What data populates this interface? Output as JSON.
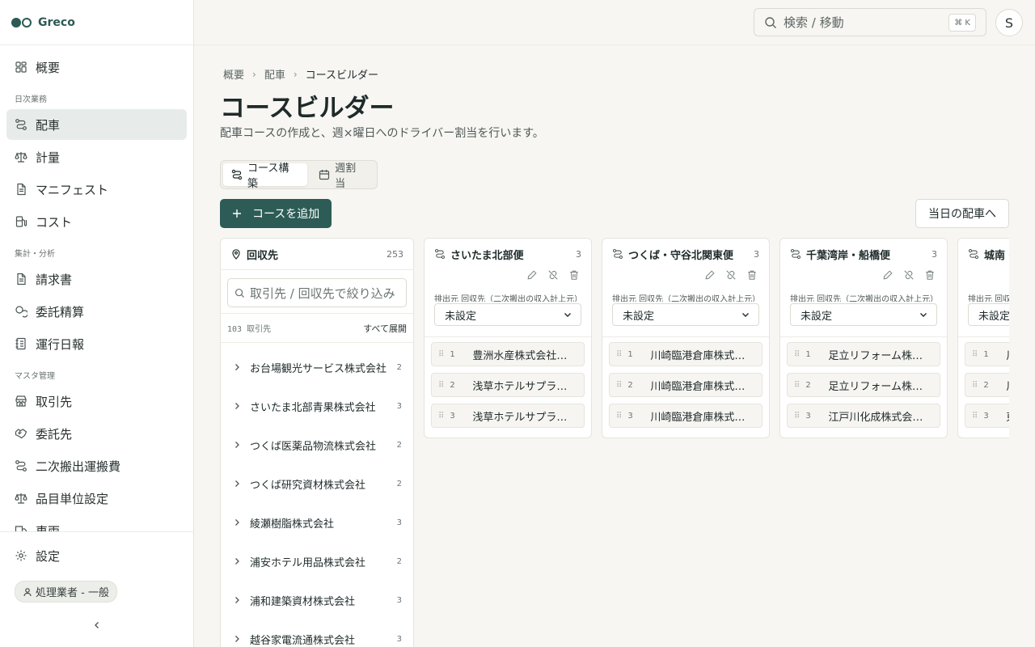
{
  "app": {
    "name": "Greco"
  },
  "nav": {
    "top": [
      {
        "label": "概要",
        "icon": "dashboard-icon"
      }
    ],
    "sections": [
      {
        "title": "日次業務",
        "items": [
          {
            "label": "配車",
            "icon": "route-icon",
            "active": true
          },
          {
            "label": "計量",
            "icon": "scale-icon"
          },
          {
            "label": "マニフェスト",
            "icon": "document-icon"
          },
          {
            "label": "コスト",
            "icon": "fuel-icon"
          }
        ]
      },
      {
        "title": "集計・分析",
        "items": [
          {
            "label": "請求書",
            "icon": "document-icon"
          },
          {
            "label": "委託精算",
            "icon": "coins-icon"
          },
          {
            "label": "運行日報",
            "icon": "report-icon"
          }
        ]
      },
      {
        "title": "マスタ管理",
        "items": [
          {
            "label": "取引先",
            "icon": "store-icon"
          },
          {
            "label": "委託先",
            "icon": "handshake-icon"
          },
          {
            "label": "二次搬出運搬費",
            "icon": "route-icon"
          },
          {
            "label": "品目単位設定",
            "icon": "scale-icon"
          },
          {
            "label": "車両",
            "icon": "truck-icon"
          }
        ]
      }
    ],
    "settings": "設定",
    "role": "処理業者 - 一般"
  },
  "topbar": {
    "search_placeholder": "検索 / 移動",
    "shortcut": "⌘ K",
    "avatar": "S"
  },
  "breadcrumb": [
    "概要",
    "配車",
    "コースビルダー"
  ],
  "page": {
    "title": "コースビルダー",
    "description": "配車コースの作成と、週×曜日へのドライバー割当を行います。"
  },
  "tabs": [
    {
      "label": "コース構築",
      "active": true
    },
    {
      "label": "週割当",
      "active": false
    }
  ],
  "actions": {
    "add_course": "コースを追加",
    "today_dispatch": "当日の配車へ"
  },
  "pool": {
    "title": "回収先",
    "count": "253",
    "search_placeholder": "取引先 / 回収先で絞り込み",
    "summary": "103 取引先",
    "expand_all": "すべて展開",
    "rows": [
      {
        "name": "お台場観光サービス株式会社",
        "count": "2"
      },
      {
        "name": "さいたま北部青果株式会社",
        "count": "3"
      },
      {
        "name": "つくば医薬品物流株式会社",
        "count": "2"
      },
      {
        "name": "つくば研究資材株式会社",
        "count": "2"
      },
      {
        "name": "綾瀬樹脂株式会社",
        "count": "3"
      },
      {
        "name": "浦安ホテル用品株式会社",
        "count": "2"
      },
      {
        "name": "浦和建築資材株式会社",
        "count": "3"
      },
      {
        "name": "越谷家電流通株式会社",
        "count": "3"
      }
    ]
  },
  "courses": [
    {
      "name": "さいたま北部便",
      "count": "3",
      "origin_label": "排出元 回収先（二次搬出の収入計上元）",
      "origin_value": "未設定",
      "stops": [
        {
          "idx": "1",
          "name": "豊洲水産株式会社…"
        },
        {
          "idx": "2",
          "name": "浅草ホテルサプラ…"
        },
        {
          "idx": "3",
          "name": "浅草ホテルサプラ…"
        }
      ]
    },
    {
      "name": "つくば・守谷北関東便",
      "count": "3",
      "origin_label": "排出元 回収先（二次搬出の収入計上元）",
      "origin_value": "未設定",
      "stops": [
        {
          "idx": "1",
          "name": "川崎臨港倉庫株式…"
        },
        {
          "idx": "2",
          "name": "川崎臨港倉庫株式…"
        },
        {
          "idx": "3",
          "name": "川崎臨港倉庫株式…"
        }
      ]
    },
    {
      "name": "千葉湾岸・船橋便",
      "count": "3",
      "origin_label": "排出元 回収先（二次搬出の収入計上元）",
      "origin_value": "未設定",
      "stops": [
        {
          "idx": "1",
          "name": "足立リフォーム株…"
        },
        {
          "idx": "2",
          "name": "足立リフォーム株…"
        },
        {
          "idx": "3",
          "name": "江戸川化成株式会…"
        }
      ]
    },
    {
      "name": "城南・",
      "count": "",
      "origin_label": "排出元 回収",
      "origin_value": "未設定",
      "stops": [
        {
          "idx": "1",
          "name": "川"
        },
        {
          "idx": "2",
          "name": "川"
        },
        {
          "idx": "3",
          "name": "東"
        }
      ]
    }
  ],
  "colors": {
    "accent": "#2d5c56",
    "active_nav": "#e7ecea",
    "background": "#f7f6f2"
  }
}
